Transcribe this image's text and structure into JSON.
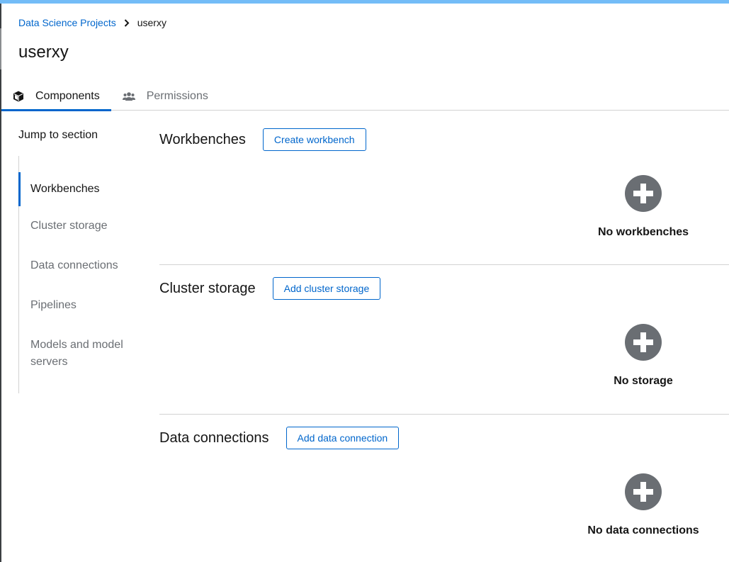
{
  "breadcrumb": {
    "parent": "Data Science Projects",
    "current": "userxy"
  },
  "page_title": "userxy",
  "tabs": [
    {
      "label": "Components",
      "icon": "cube-icon",
      "active": true
    },
    {
      "label": "Permissions",
      "icon": "users-icon",
      "active": false
    }
  ],
  "jump": {
    "title": "Jump to section",
    "items": [
      {
        "label": "Workbenches",
        "active": true
      },
      {
        "label": "Cluster storage",
        "active": false
      },
      {
        "label": "Data connections",
        "active": false
      },
      {
        "label": "Pipelines",
        "active": false
      },
      {
        "label": "Models and model servers",
        "active": false
      }
    ]
  },
  "sections": [
    {
      "title": "Workbenches",
      "button": "Create workbench",
      "empty": "No workbenches"
    },
    {
      "title": "Cluster storage",
      "button": "Add cluster storage",
      "empty": "No storage"
    },
    {
      "title": "Data connections",
      "button": "Add data connection",
      "empty": "No data connections"
    }
  ],
  "colors": {
    "accent": "#0066cc",
    "top_bar": "#73bcf7",
    "muted": "#6a6e73",
    "border": "#d2d2d2"
  }
}
